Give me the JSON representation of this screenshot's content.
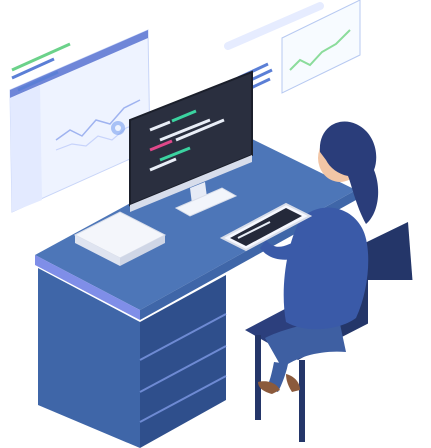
{
  "scene": {
    "subject": "developer-at-desk",
    "elements": [
      "floating-dashboard-panel",
      "floating-line-chart-card",
      "code-monitor",
      "paper-stack",
      "tablet",
      "chair",
      "woman-worker"
    ]
  },
  "colors": {
    "background": "#ffffff",
    "desk_top": "#4d76b8",
    "desk_front": "#3f66a8",
    "desk_side": "#2f4f8c",
    "desk_edge": "#7f8ee8",
    "monitor_screen": "#2a2f3f",
    "code_green": "#3bd3a0",
    "code_pink": "#e0488a",
    "code_white": "#e9eef7",
    "panel_bg": "#eef3ff",
    "panel_line_blue": "#5b7fd6",
    "panel_line_green": "#6bd28a",
    "chart_card_green": "#8bdc9b",
    "hair": "#2a3d7a",
    "skin": "#f2c6a6",
    "top": "#3a5aa8",
    "pants": "#3e5fa2",
    "chair_seat": "#2c3f7d",
    "chair_frame": "#243669",
    "shoes": "#8b5a3c"
  }
}
